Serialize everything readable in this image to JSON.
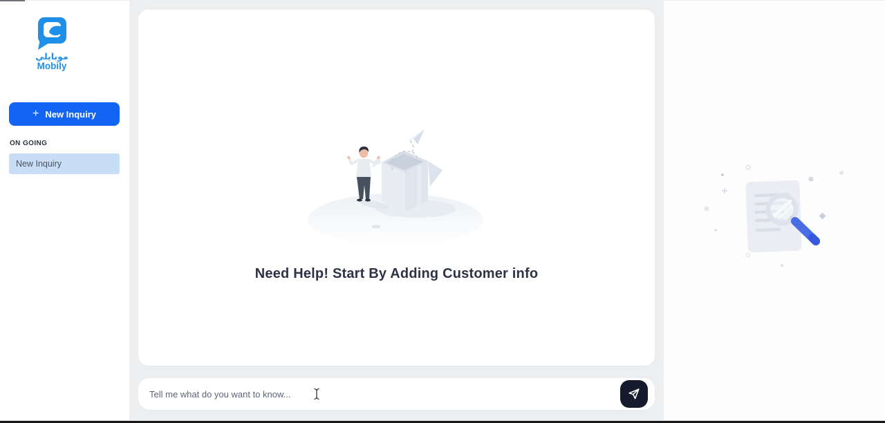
{
  "brand": {
    "name_arabic": "موبايلي",
    "name_latin": "Mobily"
  },
  "sidebar": {
    "new_inquiry_button": {
      "plus": "+",
      "label": "New Inquiry"
    },
    "ongoing_section": {
      "label": "ON GOING",
      "items": [
        {
          "label": "New Inquiry"
        }
      ]
    }
  },
  "main": {
    "empty_state": {
      "heading": "Need Help! Start By Adding Customer info",
      "illustration": "person-open-box-paper-plane"
    }
  },
  "composer": {
    "placeholder": "Tell me what do you want to know...",
    "send_icon": "paper-plane-send"
  },
  "right_panel": {
    "illustration": "document-magnifier-search"
  },
  "colors": {
    "primary_blue": "#1464f4",
    "brand_blue": "#1e90e9",
    "active_item_bg": "#c8def6",
    "heading_text": "#2e3247",
    "placeholder_text": "#5d6575",
    "send_button_bg": "#151b2c",
    "canvas_gray": "#eceef0",
    "magnifier_handle_blue": "#4a6de6"
  }
}
